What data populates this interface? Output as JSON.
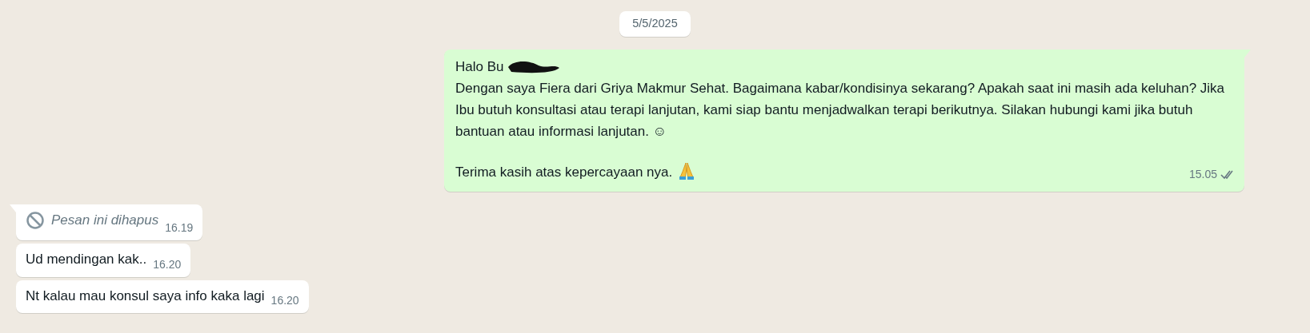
{
  "date_chip": "5/5/2025",
  "outgoing": [
    {
      "greeting": "Halo Bu",
      "redacted": true,
      "paragraphs": [
        "Dengan saya Fiera dari Griya Makmur Sehat. Bagaimana kabar/kondisinya sekarang? Apakah saat ini masih ada keluhan? Jika Ibu butuh konsultasi atau terapi lanjutan, kami siap bantu menjadwalkan terapi berikutnya. Silakan hubungi kami jika butuh bantuan atau informasi lanjutan. ☺",
        "Terima kasih atas kepercayaan nya."
      ],
      "time": "15.05",
      "read": false,
      "tail": true
    }
  ],
  "incoming": [
    {
      "kind": "deleted",
      "text": "Pesan ini dihapus",
      "time": "16.19",
      "tail": true
    },
    {
      "kind": "text",
      "text": "Ud mendingan kak..",
      "time": "16.20",
      "tail": false
    },
    {
      "kind": "text",
      "text": "Nt kalau mau konsul saya info kaka lagi",
      "time": "16.20",
      "tail": false
    }
  ]
}
